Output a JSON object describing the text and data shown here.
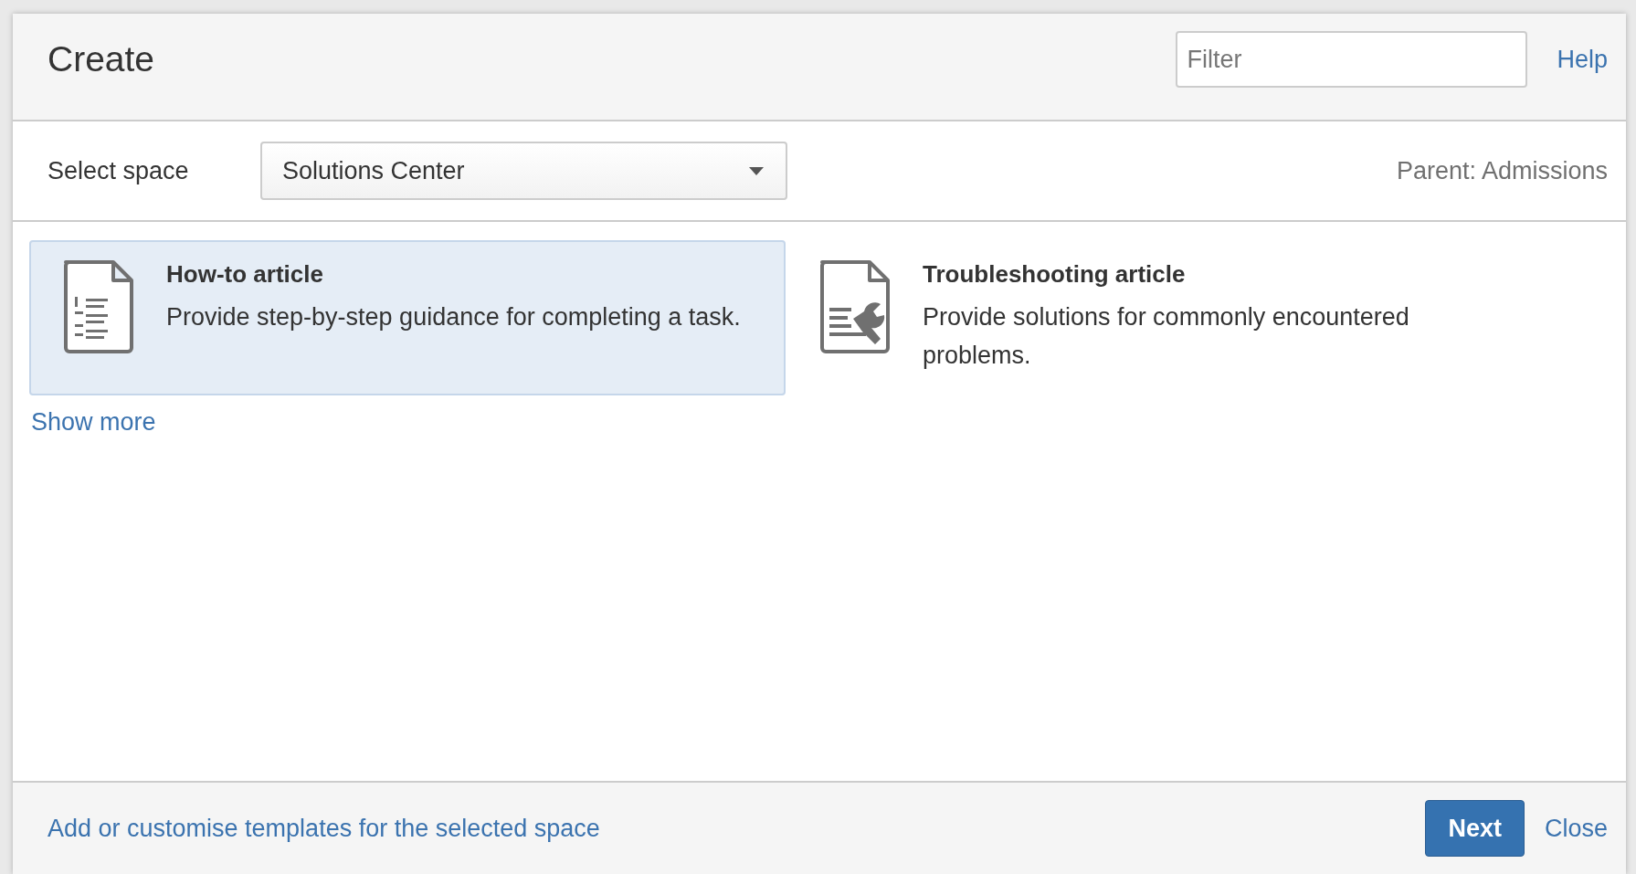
{
  "dialog": {
    "title": "Create",
    "filter": {
      "placeholder": "Filter"
    },
    "help_link": "Help"
  },
  "space_bar": {
    "label": "Select space",
    "space_select": "Solutions Center",
    "parent": "Parent: Admissions"
  },
  "templates": [
    {
      "title": "How-to article",
      "description": "Provide step-by-step guidance for completing a task.",
      "selected": true
    },
    {
      "title": "Troubleshooting article",
      "description": "Provide solutions for commonly encountered problems.",
      "selected": false
    }
  ],
  "show_more": "Show more",
  "footer": {
    "customise_link": "Add or customise templates for the selected space",
    "buttons": [
      {
        "label": "Next",
        "kind": "primary"
      },
      {
        "label": "Close",
        "kind": "link"
      }
    ]
  }
}
